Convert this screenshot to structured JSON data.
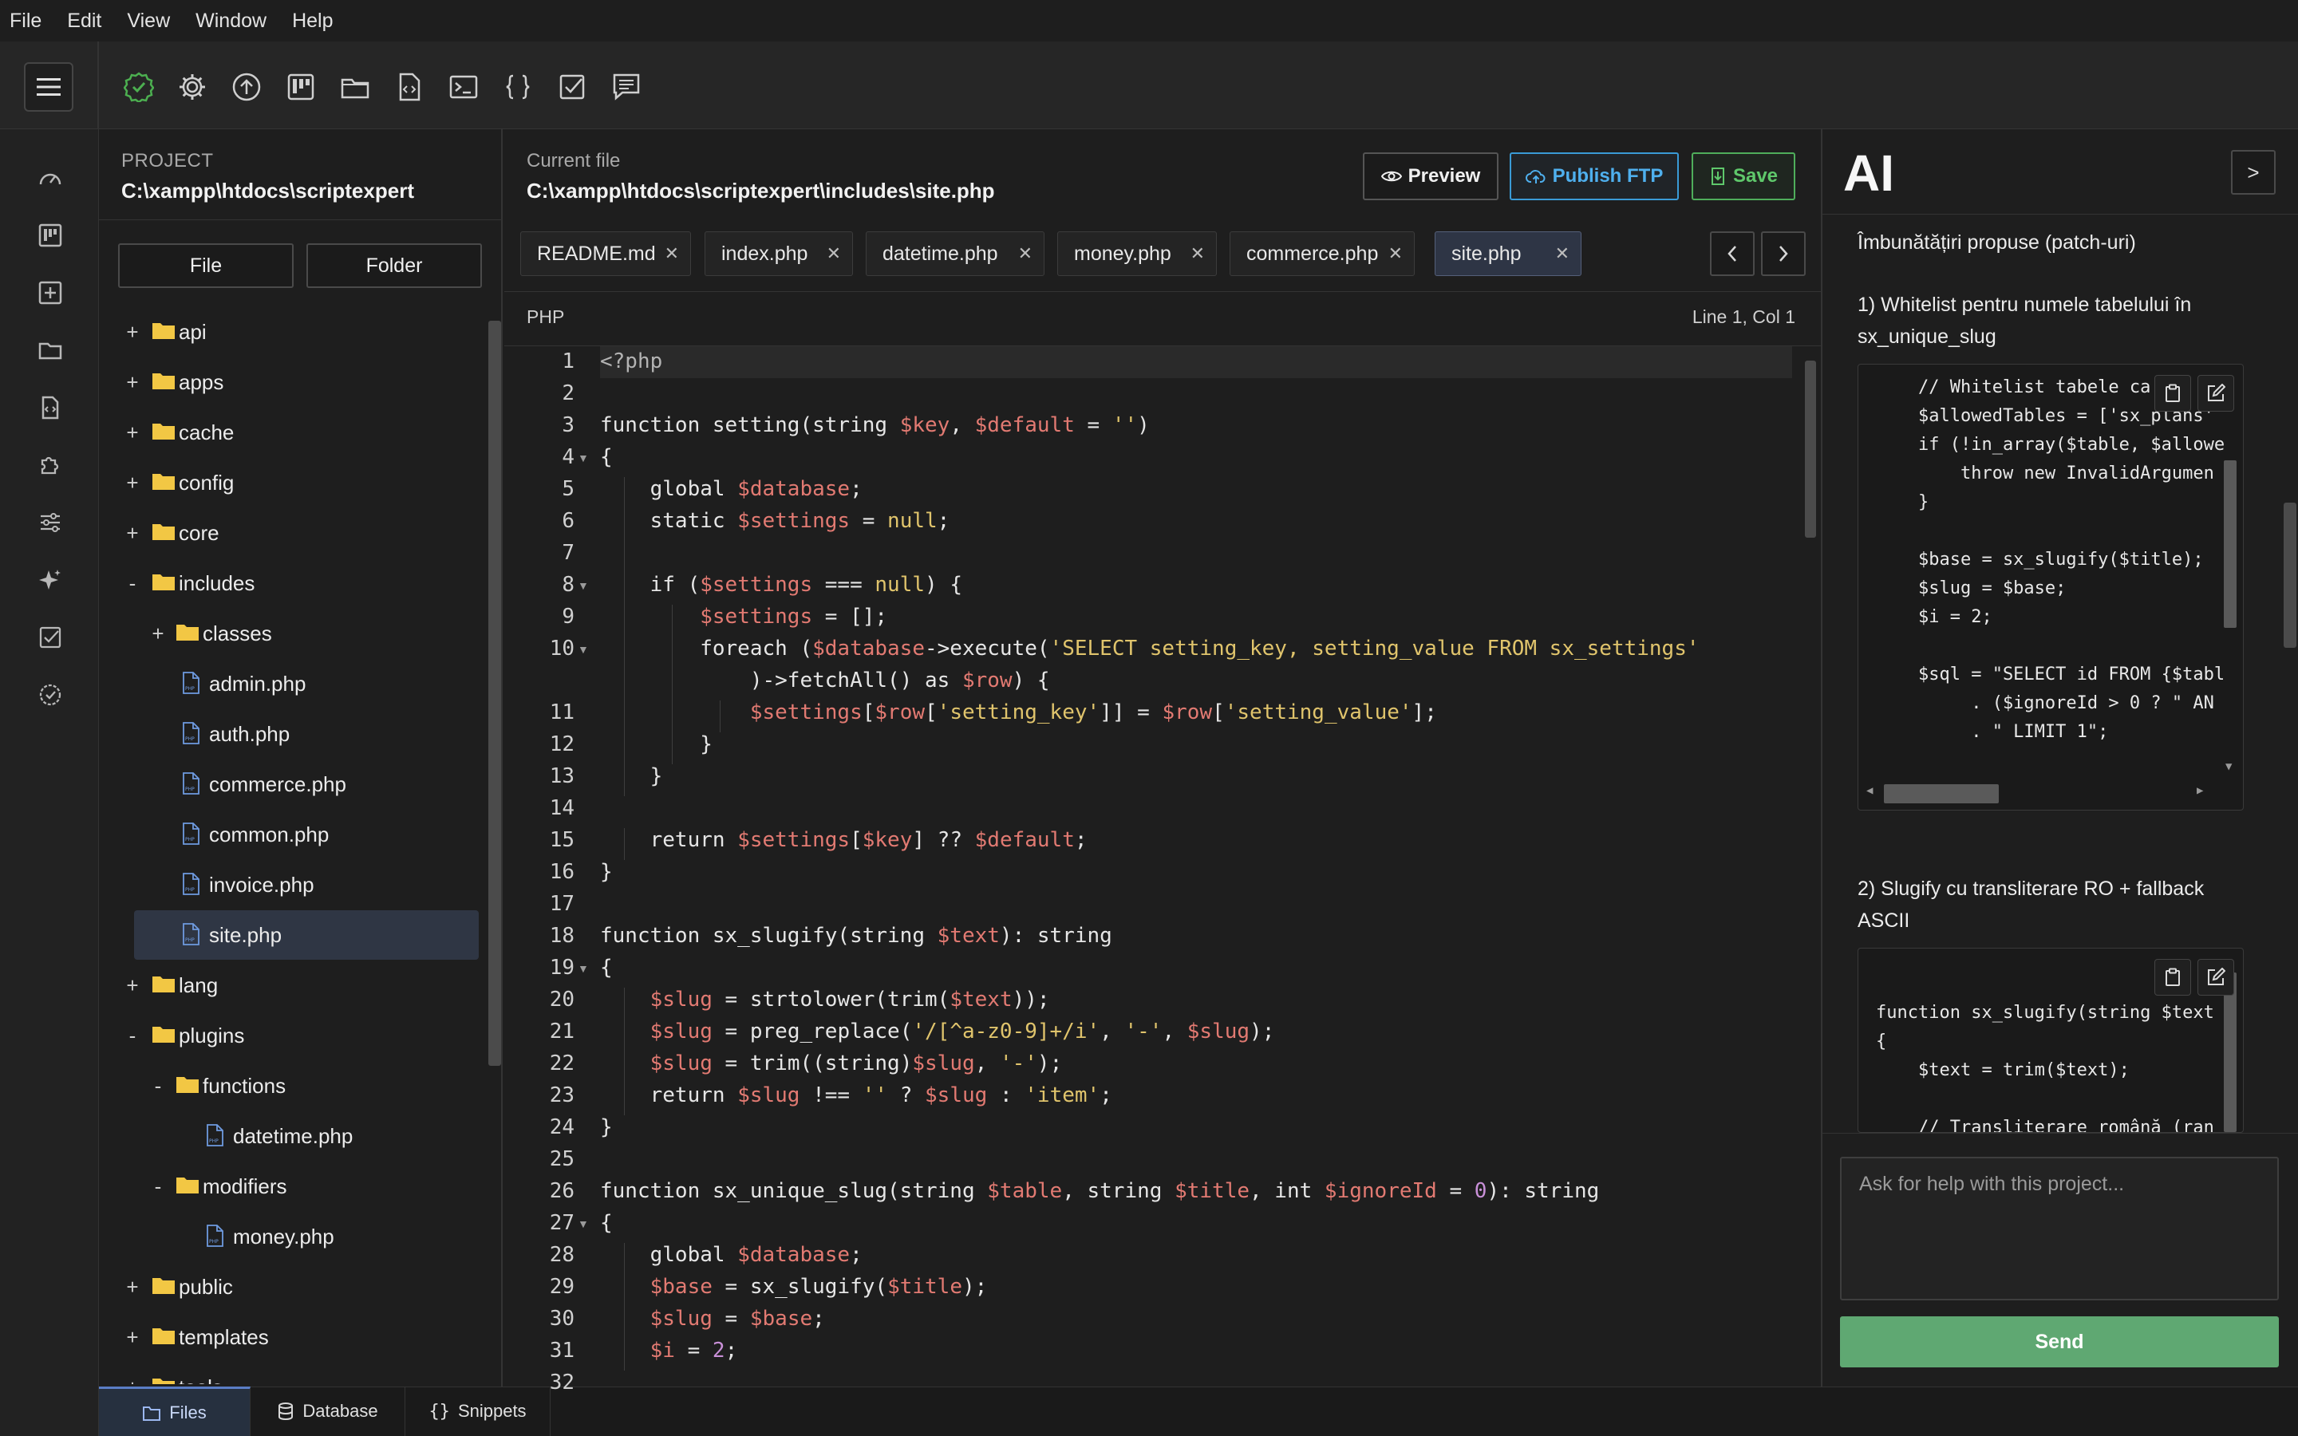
{
  "menu": [
    "File",
    "Edit",
    "View",
    "Window",
    "Help"
  ],
  "sidebar": {
    "project_label": "PROJECT",
    "project_path": "C:\\xampp\\htdocs\\scriptexpert",
    "file_button": "File",
    "folder_button": "Folder",
    "tree": [
      {
        "toggle": "+",
        "name": "api",
        "type": "folder",
        "depth": 0
      },
      {
        "toggle": "+",
        "name": "apps",
        "type": "folder",
        "depth": 0
      },
      {
        "toggle": "+",
        "name": "cache",
        "type": "folder",
        "depth": 0
      },
      {
        "toggle": "+",
        "name": "config",
        "type": "folder",
        "depth": 0
      },
      {
        "toggle": "+",
        "name": "core",
        "type": "folder",
        "depth": 0
      },
      {
        "toggle": "-",
        "name": "includes",
        "type": "folder",
        "depth": 0
      },
      {
        "toggle": "+",
        "name": "classes",
        "type": "folder",
        "depth": 1
      },
      {
        "toggle": "",
        "name": "admin.php",
        "type": "file",
        "depth": 1
      },
      {
        "toggle": "",
        "name": "auth.php",
        "type": "file",
        "depth": 1
      },
      {
        "toggle": "",
        "name": "commerce.php",
        "type": "file",
        "depth": 1
      },
      {
        "toggle": "",
        "name": "common.php",
        "type": "file",
        "depth": 1
      },
      {
        "toggle": "",
        "name": "invoice.php",
        "type": "file",
        "depth": 1
      },
      {
        "toggle": "",
        "name": "site.php",
        "type": "file",
        "depth": 1,
        "selected": true
      },
      {
        "toggle": "+",
        "name": "lang",
        "type": "folder",
        "depth": 0
      },
      {
        "toggle": "-",
        "name": "plugins",
        "type": "folder",
        "depth": 0
      },
      {
        "toggle": "-",
        "name": "functions",
        "type": "folder",
        "depth": 1
      },
      {
        "toggle": "",
        "name": "datetime.php",
        "type": "file",
        "depth": 2
      },
      {
        "toggle": "-",
        "name": "modifiers",
        "type": "folder",
        "depth": 1
      },
      {
        "toggle": "",
        "name": "money.php",
        "type": "file",
        "depth": 2
      },
      {
        "toggle": "+",
        "name": "public",
        "type": "folder",
        "depth": 0
      },
      {
        "toggle": "+",
        "name": "templates",
        "type": "folder",
        "depth": 0
      },
      {
        "toggle": "+",
        "name": "tools",
        "type": "folder",
        "depth": 0
      }
    ]
  },
  "bottom_tabs": {
    "files": "Files",
    "database": "Database",
    "snippets": "Snippets"
  },
  "editor": {
    "current_file_label": "Current file",
    "current_file_path": "C:\\xampp\\htdocs\\scriptexpert\\includes\\site.php",
    "preview": "Preview",
    "publish": "Publish FTP",
    "save": "Save",
    "tabs": [
      "README.md",
      "index.php",
      "datetime.php",
      "money.php",
      "commerce.php",
      "site.php"
    ],
    "active_tab": "site.php",
    "language": "PHP",
    "cursor": "Line 1, Col 1",
    "line_numbers": [
      "1",
      "2",
      "3",
      "4",
      "5",
      "6",
      "7",
      "8",
      "9",
      "10",
      "",
      "11",
      "12",
      "13",
      "14",
      "15",
      "16",
      "17",
      "18",
      "19",
      "20",
      "21",
      "22",
      "23",
      "24",
      "25",
      "26",
      "27",
      "28",
      "29",
      "30",
      "31",
      "32"
    ]
  },
  "ai": {
    "title": "AI",
    "toggle": ">",
    "heading": "Îmbunătățiri propuse (patch-uri)",
    "section1": "1) Whitelist pentru numele tabelului în sx_unique_slug",
    "code1": [
      "    // Whitelist tabele ca",
      "    $allowedTables = ['sx_plans'",
      "    if (!in_array($table, $allowe",
      "        throw new InvalidArgumen",
      "    }",
      "",
      "    $base = sx_slugify($title);",
      "    $slug = $base;",
      "    $i = 2;",
      "",
      "    $sql = \"SELECT id FROM {$tabl",
      "         . ($ignoreId > 0 ? \" AN",
      "         . \" LIMIT 1\";"
    ],
    "section2": "2) Slugify cu transliterare RO + fallback ASCII",
    "code2": [
      "function sx_slugify(string $text",
      "{",
      "    $text = trim($text);",
      "",
      "    // Transliterare română (ran"
    ],
    "input_placeholder": "Ask for help with this project...",
    "send": "Send"
  },
  "colors": {
    "accent_blue": "#3a9bd6",
    "save_green": "#4fae5b",
    "send_green": "#5fa872",
    "folder_yellow": "#f2c744",
    "check_green": "#4caf50"
  }
}
